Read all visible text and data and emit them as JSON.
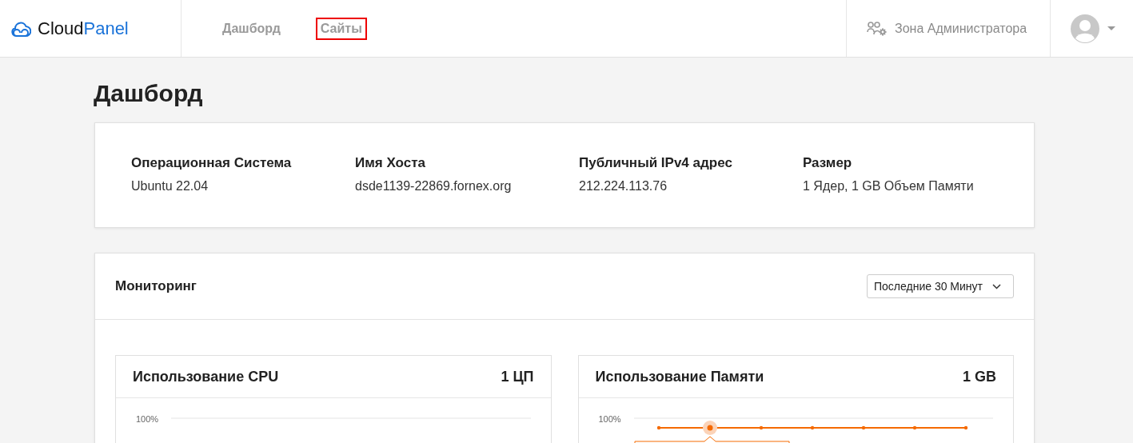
{
  "header": {
    "logo": {
      "part_1": "Cloud",
      "part_2": "Panel"
    },
    "nav": [
      {
        "label": "Дашборд",
        "highlighted": false
      },
      {
        "label": "Сайты",
        "highlighted": true
      }
    ],
    "admin_zone": "Зона Администратора"
  },
  "page_title": "Дашборд",
  "server_info": [
    {
      "label": "Операционная Система",
      "value": "Ubuntu 22.04"
    },
    {
      "label": "Имя Хоста",
      "value": "dsde1139-22869.fornex.org"
    },
    {
      "label": "Публичный IPv4 адрес",
      "value": "212.224.113.76"
    },
    {
      "label": "Размер",
      "value": "1 Ядер, 1 GB Объем Памяти"
    }
  ],
  "monitoring": {
    "title": "Мониторинг",
    "range_select": "Последние 30 Минут",
    "charts": [
      {
        "title": "Использование CPU",
        "capacity": "1 ЦП",
        "axis_label": "100%",
        "kind": "empty"
      },
      {
        "title": "Использование Памяти",
        "capacity": "1 GB",
        "axis_label": "100%",
        "kind": "line"
      }
    ]
  }
}
